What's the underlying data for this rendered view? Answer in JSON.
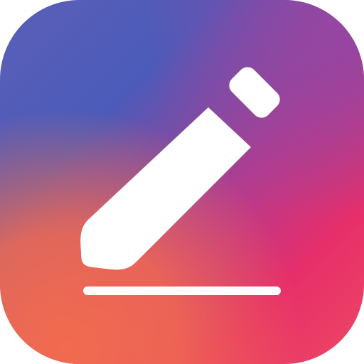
{
  "icon": {
    "name": "notes-app-icon",
    "glyph": "pencil-icon",
    "underline": "writing-line"
  },
  "colors": {
    "background": "#ffffff",
    "gradient_top_left": "#5B5FB8",
    "gradient_blue": "#4B5CB8",
    "gradient_purple": "#9446A2",
    "gradient_magenta": "#E62E6B",
    "gradient_coral": "#F05F56",
    "pencil_fill": "#ffffff",
    "underline_fill": "#ffffff"
  }
}
